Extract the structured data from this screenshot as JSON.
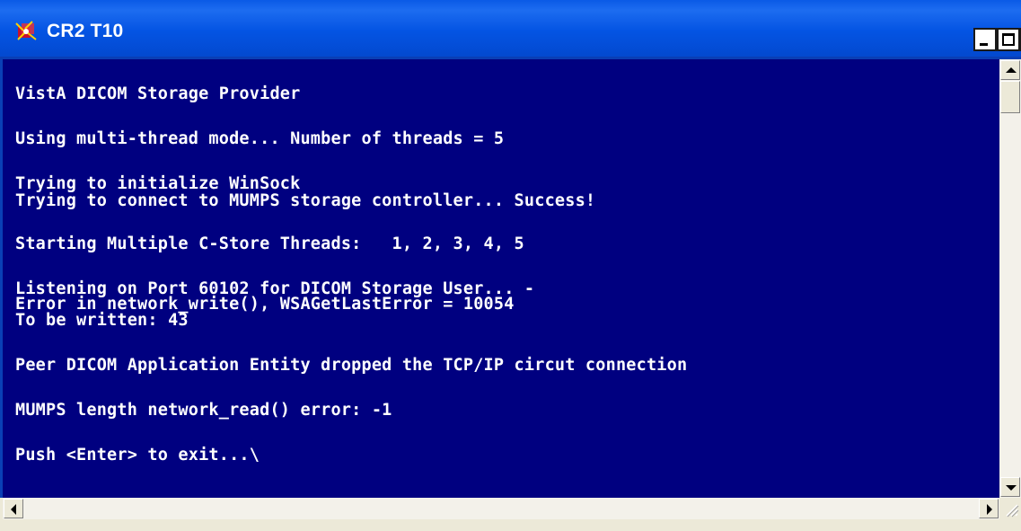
{
  "window": {
    "title": "CR2 T10",
    "icon": "dicom-app-icon"
  },
  "console": {
    "lines": [
      "VistA DICOM Storage Provider",
      "Using multi-thread mode... Number of threads = 5",
      "Trying to initialize WinSock",
      "Trying to connect to MUMPS storage controller... Success!",
      "Starting Multiple C-Store Threads:   1, 2, 3, 4, 5",
      "Listening on Port 60102 for DICOM Storage User... -",
      "Error in network_write(), WSAGetLastError = 10054",
      "To be written: 43",
      "Peer DICOM Application Entity dropped the TCP/IP circut connection",
      "MUMPS length network_read() error: -1",
      "Push <Enter> to exit...\\"
    ]
  },
  "colors": {
    "console_bg": "#000080",
    "console_fg": "#ffffff",
    "titlebar": "#0454e3"
  }
}
